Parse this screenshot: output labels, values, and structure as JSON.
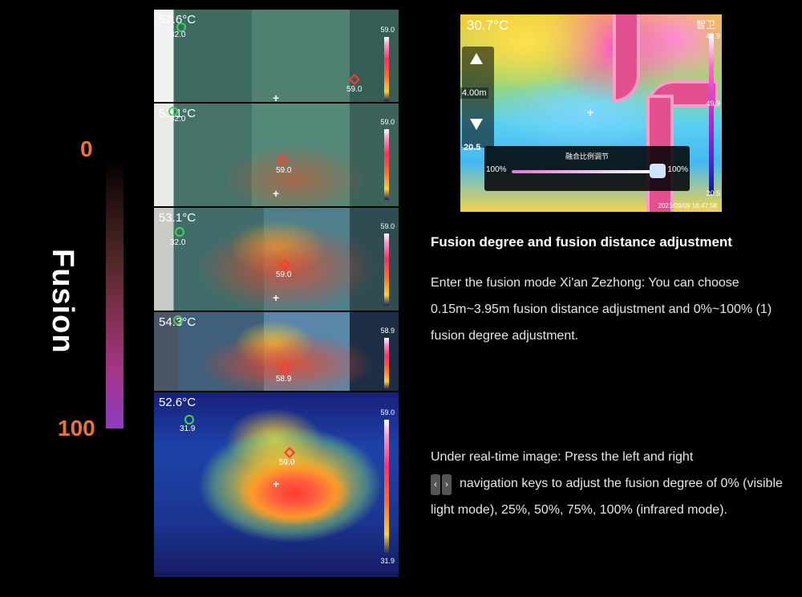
{
  "scale": {
    "top_label": "0",
    "bottom_label": "100",
    "title": "Fusion"
  },
  "frames": [
    {
      "temp": "52.6°C",
      "small": "32.0",
      "marker": "59.0",
      "bar_top": "59.0"
    },
    {
      "temp": "53.1°C",
      "small": "32.0",
      "marker": "59.0",
      "bar_top": "59.0"
    },
    {
      "temp": "53.1°C",
      "small": "32.0",
      "marker": "59.0",
      "bar_top": "59.0"
    },
    {
      "temp": "54.3°C",
      "marker": "58.9",
      "bar_top": "58.9"
    },
    {
      "temp": "52.6°C",
      "small": "31.9",
      "marker": "59.0",
      "bar_top": "59.0",
      "bar_bottom": "31.9"
    }
  ],
  "device": {
    "temp": "30.7°C",
    "brand": "智卫",
    "distance": "4.00m",
    "low_value": "20.5",
    "bar_top": "49.9",
    "bar_mid": "49.9",
    "bar_bottom": "20.5",
    "slider_title": "融合比例调节",
    "slider_left": "100%",
    "slider_right": "100%",
    "datetime": "2021/09/09  16:47:58"
  },
  "text": {
    "heading": "Fusion degree and fusion distance adjustment",
    "para1": "Enter the fusion mode Xi'an Zezhong: You can choose 0.15m~3.95m fusion distance adjustment and 0%~100% (1) fusion degree adjustment.",
    "para2_a": "Under real-time image: Press the left and right",
    "para2_b": "navigation keys to adjust the fusion degree of 0% (visible light mode), 25%, 50%, 75%, 100% (infrared mode).",
    "key_left": "‹",
    "key_right": "›"
  }
}
